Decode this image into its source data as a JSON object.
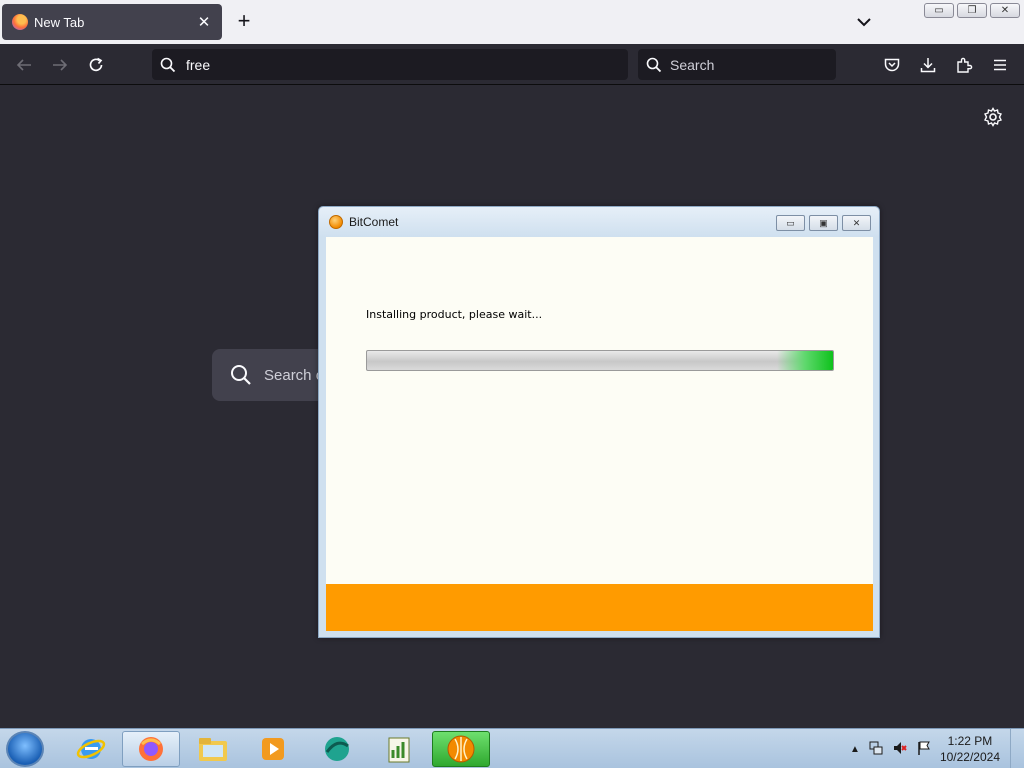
{
  "browser": {
    "tab": {
      "title": "New Tab",
      "close_glyph": "✕"
    },
    "new_tab_glyph": "+",
    "url_value": "free",
    "search_placeholder": "Search",
    "page_search_placeholder": "Search o"
  },
  "dialog": {
    "title": "BitComet",
    "message": "Installing product, please wait...",
    "progress_percent": 100,
    "accent_color": "#ff9b00"
  },
  "taskbar": {
    "time": "1:22 PM",
    "date": "10/22/2024"
  }
}
